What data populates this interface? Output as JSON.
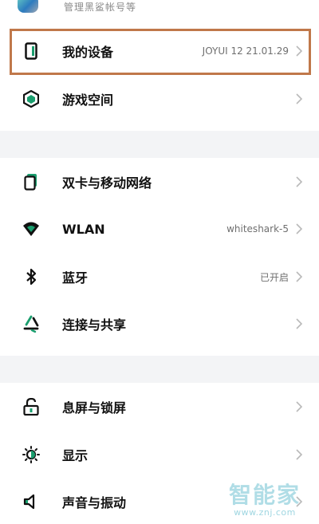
{
  "top_item": {
    "description": "管理黑鲨帐号等"
  },
  "settings": [
    {
      "label": "我的设备",
      "value": "JOYUI 12 21.01.29",
      "icon": "device-icon"
    },
    {
      "label": "游戏空间",
      "value": "",
      "icon": "game-space-icon"
    },
    {
      "label": "双卡与移动网络",
      "value": "",
      "icon": "sim-card-icon"
    },
    {
      "label": "WLAN",
      "value": "whiteshark-5",
      "icon": "wifi-icon"
    },
    {
      "label": "蓝牙",
      "value": "已开启",
      "icon": "bluetooth-icon"
    },
    {
      "label": "连接与共享",
      "value": "",
      "icon": "connection-share-icon"
    },
    {
      "label": "息屏与锁屏",
      "value": "",
      "icon": "lock-icon"
    },
    {
      "label": "显示",
      "value": "",
      "icon": "display-brightness-icon"
    },
    {
      "label": "声音与振动",
      "value": "",
      "icon": "sound-icon"
    }
  ],
  "watermark": {
    "title": "智能家",
    "url": "www.znj.com"
  },
  "colors": {
    "accent_green": "#1a9e6e",
    "highlight_border": "#c0784a",
    "divider_bg": "#f3f4f6",
    "chevron": "#b9b9b9"
  }
}
